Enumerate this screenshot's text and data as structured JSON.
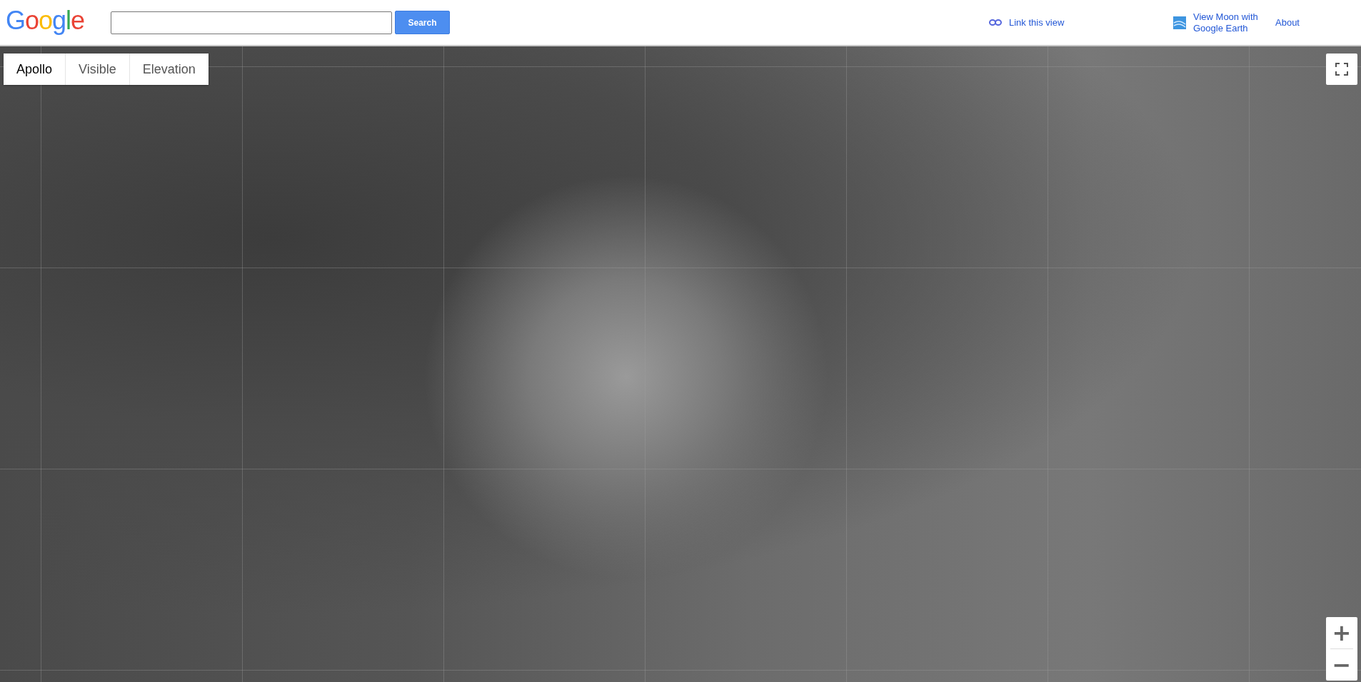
{
  "header": {
    "logo": "Google",
    "search": {
      "button": "Search"
    },
    "links": [
      {
        "kind": "link",
        "label": "Link this view"
      },
      {
        "kind": "earth",
        "label": "View Moon with Google Earth"
      },
      {
        "kind": "plain",
        "label": "About"
      }
    ]
  },
  "map": {
    "tabs": [
      {
        "label": "Apollo",
        "selected": true
      },
      {
        "label": "Visible",
        "selected": false
      },
      {
        "label": "Elevation",
        "selected": false
      }
    ],
    "zoom": [
      "+",
      "−"
    ]
  }
}
